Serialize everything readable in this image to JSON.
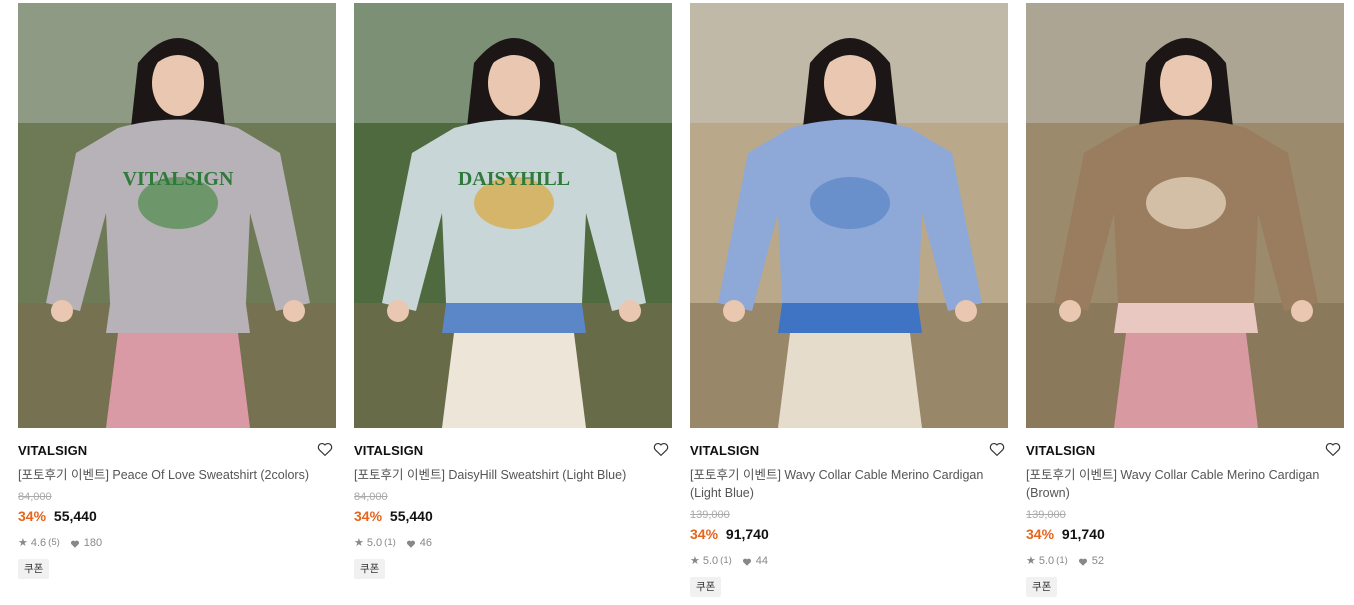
{
  "products": [
    {
      "brand": "VITALSIGN",
      "title": "[포토후기 이벤트] Peace Of Love Sweatshirt (2colors)",
      "original_price": "84,000",
      "discount": "34%",
      "price": "55,440",
      "rating": "4.6",
      "review_count": "(5)",
      "likes": "180",
      "coupon_label": "쿠폰",
      "image": {
        "sweater_color": "#b7b2b8",
        "bg": "#6e7a55",
        "accent": "#4f8a4a",
        "print": "VITALSIGN",
        "pants": "#d99aa5",
        "shirt": ""
      }
    },
    {
      "brand": "VITALSIGN",
      "title": "[포토후기 이벤트] DaisyHill Sweatshirt (Light Blue)",
      "original_price": "84,000",
      "discount": "34%",
      "price": "55,440",
      "rating": "5.0",
      "review_count": "(1)",
      "likes": "46",
      "coupon_label": "쿠폰",
      "image": {
        "sweater_color": "#c9d6d8",
        "bg": "#4f6a3e",
        "accent": "#d8a73a",
        "print": "DAISYHILL",
        "pants": "#ece5d8",
        "shirt": "#5b86c8"
      }
    },
    {
      "brand": "VITALSIGN",
      "title": "[포토후기 이벤트] Wavy Collar Cable Merino Cardigan (Light Blue)",
      "original_price": "139,000",
      "discount": "34%",
      "price": "91,740",
      "rating": "5.0",
      "review_count": "(1)",
      "likes": "44",
      "coupon_label": "쿠폰",
      "image": {
        "sweater_color": "#8ea8d8",
        "bg": "#b9a98a",
        "accent": "#5b86c8",
        "print": "",
        "pants": "#e6dccb",
        "shirt": "#3f74c4"
      }
    },
    {
      "brand": "VITALSIGN",
      "title": "[포토후기 이벤트] Wavy Collar Cable Merino Cardigan (Brown)",
      "original_price": "139,000",
      "discount": "34%",
      "price": "91,740",
      "rating": "5.0",
      "review_count": "(1)",
      "likes": "52",
      "coupon_label": "쿠폰",
      "image": {
        "sweater_color": "#9a7c5e",
        "bg": "#9b8a6c",
        "accent": "#e9dcc5",
        "print": "",
        "pants": "#d89aa0",
        "shirt": "#e8c8c0"
      }
    }
  ],
  "colors": {
    "discount": "#e8641b",
    "strike": "#aaaaaa",
    "coupon_bg": "#f1f1f1"
  },
  "icons": {
    "wishlist": "heart-outline-icon",
    "rating": "star-icon",
    "likes": "heart-filled-icon"
  }
}
